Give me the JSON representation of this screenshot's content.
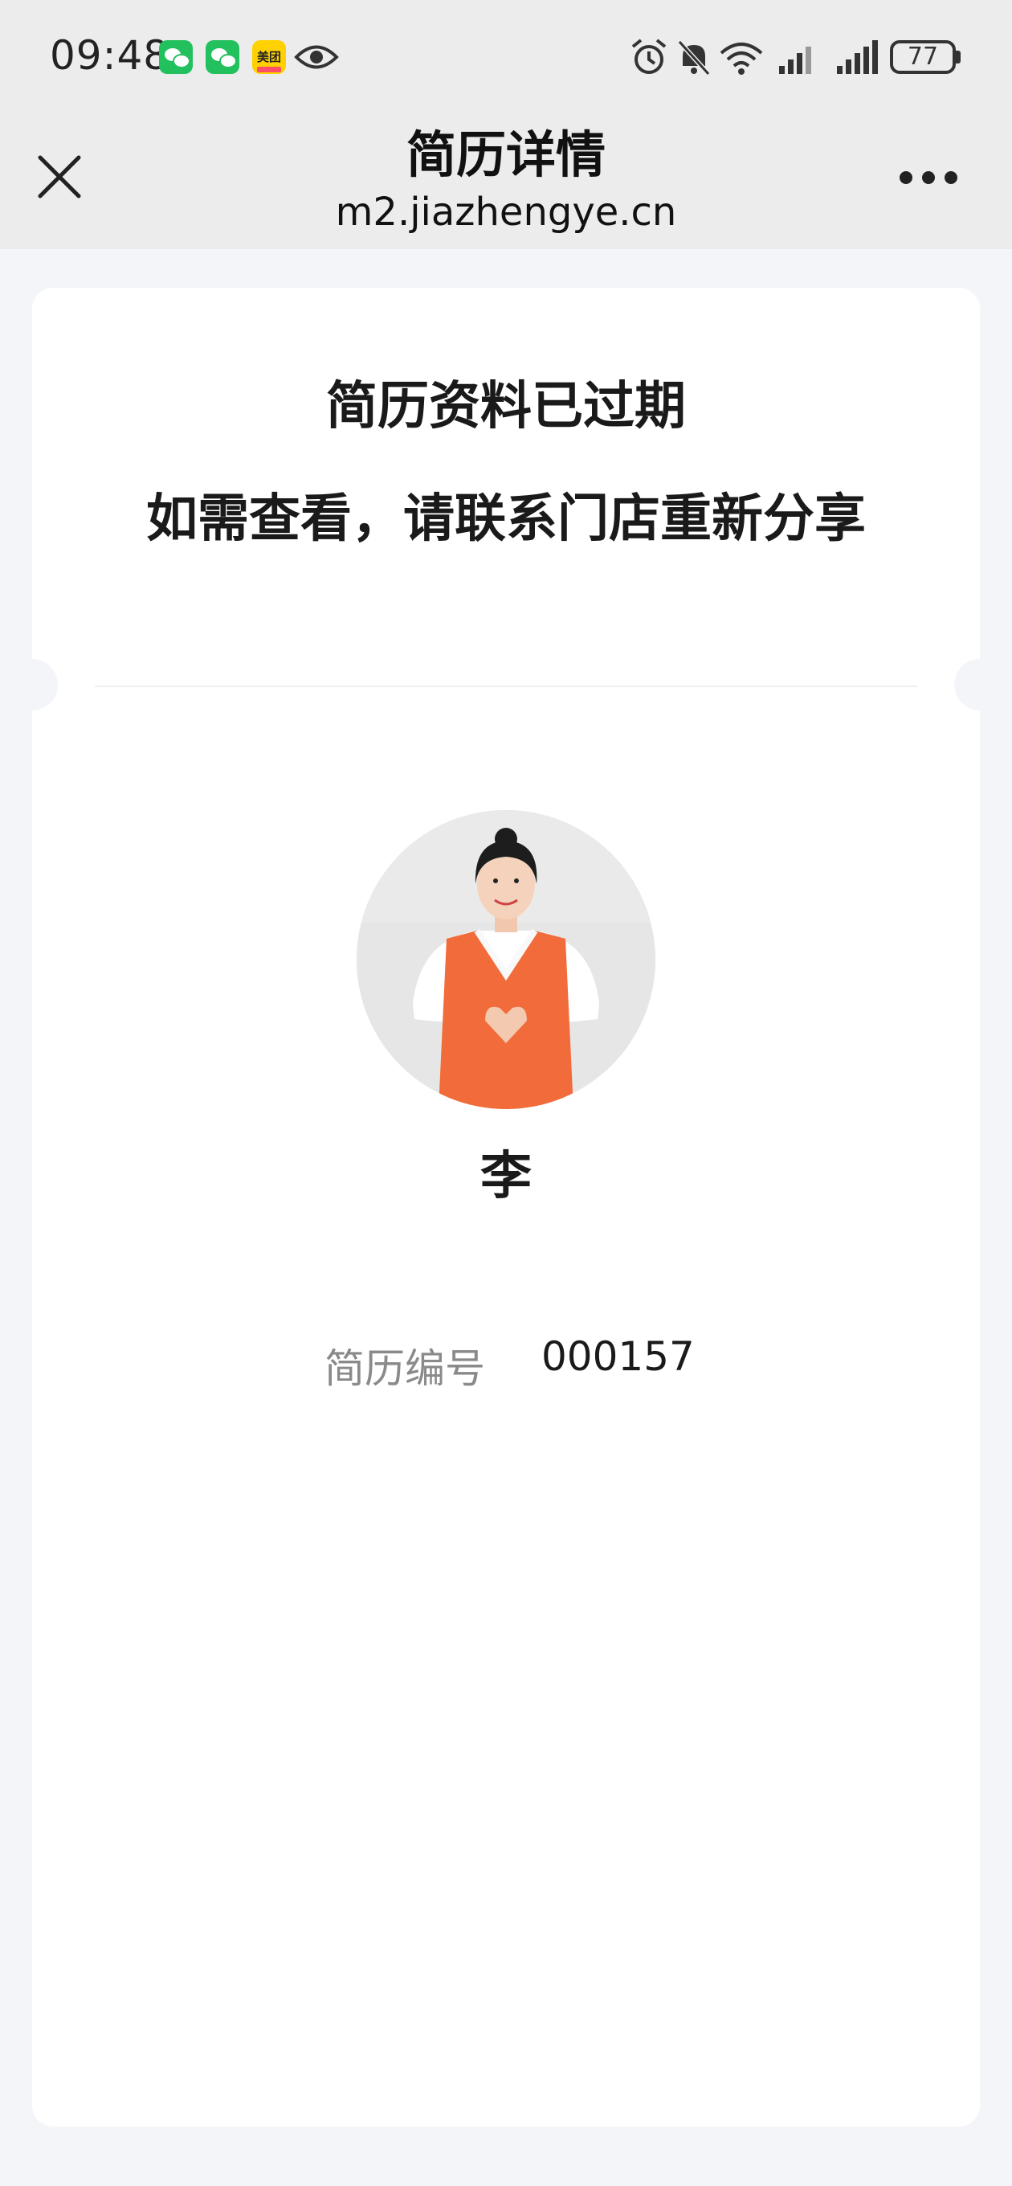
{
  "status_bar": {
    "time": "09:48",
    "meituan_label": "美团",
    "battery": "77",
    "icons": [
      "wechat-icon",
      "wechat-icon",
      "meituan-icon",
      "eye-icon",
      "alarm-icon",
      "mute-bell-icon",
      "wifi-6-icon",
      "signal-icon",
      "signal-icon",
      "battery-icon"
    ]
  },
  "nav": {
    "title": "简历详情",
    "url": "m2.jiazhengye.cn",
    "close_icon": "close-icon",
    "more_icon": "more-dots-icon"
  },
  "card": {
    "message_line1": "简历资料已过期",
    "message_line2": "如需查看，请联系门店重新分享",
    "name": "李",
    "field_label": "简历编号",
    "field_value": "000157"
  },
  "colors": {
    "background": "#f4f5f9",
    "bar": "#ececec",
    "apron": "#f26b3a",
    "wechat": "#22c15e",
    "meituan": "#ffd100"
  }
}
